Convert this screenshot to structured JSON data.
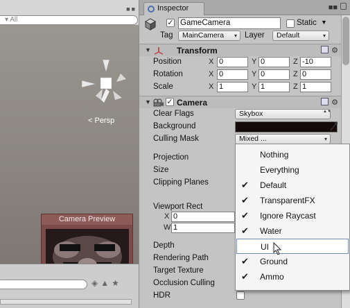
{
  "scene": {
    "search_placeholder": "▾ All",
    "persp_label": "< Persp",
    "preview_title": "Camera Preview"
  },
  "inspector": {
    "tab_label": "Inspector",
    "object": {
      "name": "GameCamera",
      "active": true,
      "static_label": "Static",
      "static_checked": false,
      "tag_label": "Tag",
      "tag_value": "MainCamera",
      "layer_label": "Layer",
      "layer_value": "Default"
    },
    "transform": {
      "title": "Transform",
      "position_label": "Position",
      "rotation_label": "Rotation",
      "scale_label": "Scale",
      "position": {
        "x": "0",
        "y": "0",
        "z": "-10"
      },
      "rotation": {
        "x": "0",
        "y": "0",
        "z": "0"
      },
      "scale": {
        "x": "1",
        "y": "1",
        "z": "1"
      }
    },
    "camera": {
      "title": "Camera",
      "clear_flags_label": "Clear Flags",
      "clear_flags_value": "Skybox",
      "background_label": "Background",
      "background_color": "#140a0a",
      "culling_mask_label": "Culling Mask",
      "culling_mask_value": "Mixed ...",
      "projection_label": "Projection",
      "size_label": "Size",
      "clipping_planes_label": "Clipping Planes",
      "viewport_rect_label": "Viewport Rect",
      "viewport_x": "0",
      "viewport_w": "1",
      "depth_label": "Depth",
      "rendering_path_label": "Rendering Path",
      "target_texture_label": "Target Texture",
      "occlusion_culling_label": "Occlusion Culling",
      "hdr_label": "HDR"
    }
  },
  "culling_menu": {
    "items": [
      {
        "label": "Nothing",
        "checked": false
      },
      {
        "label": "Everything",
        "checked": false
      },
      {
        "label": "Default",
        "checked": true
      },
      {
        "label": "TransparentFX",
        "checked": true
      },
      {
        "label": "Ignore Raycast",
        "checked": true
      },
      {
        "label": "Water",
        "checked": true
      },
      {
        "label": "UI",
        "checked": false
      },
      {
        "label": "Ground",
        "checked": true
      },
      {
        "label": "Ammo",
        "checked": true
      }
    ],
    "hover_index": 6
  },
  "axis_letters": {
    "x": "X",
    "y": "Y",
    "z": "Z",
    "w": "W"
  },
  "glyphs": {
    "check": "✔",
    "checkbox_check": "✓",
    "foldout": "▼",
    "dd_arrow": "▲▼",
    "gear": "⚙"
  }
}
